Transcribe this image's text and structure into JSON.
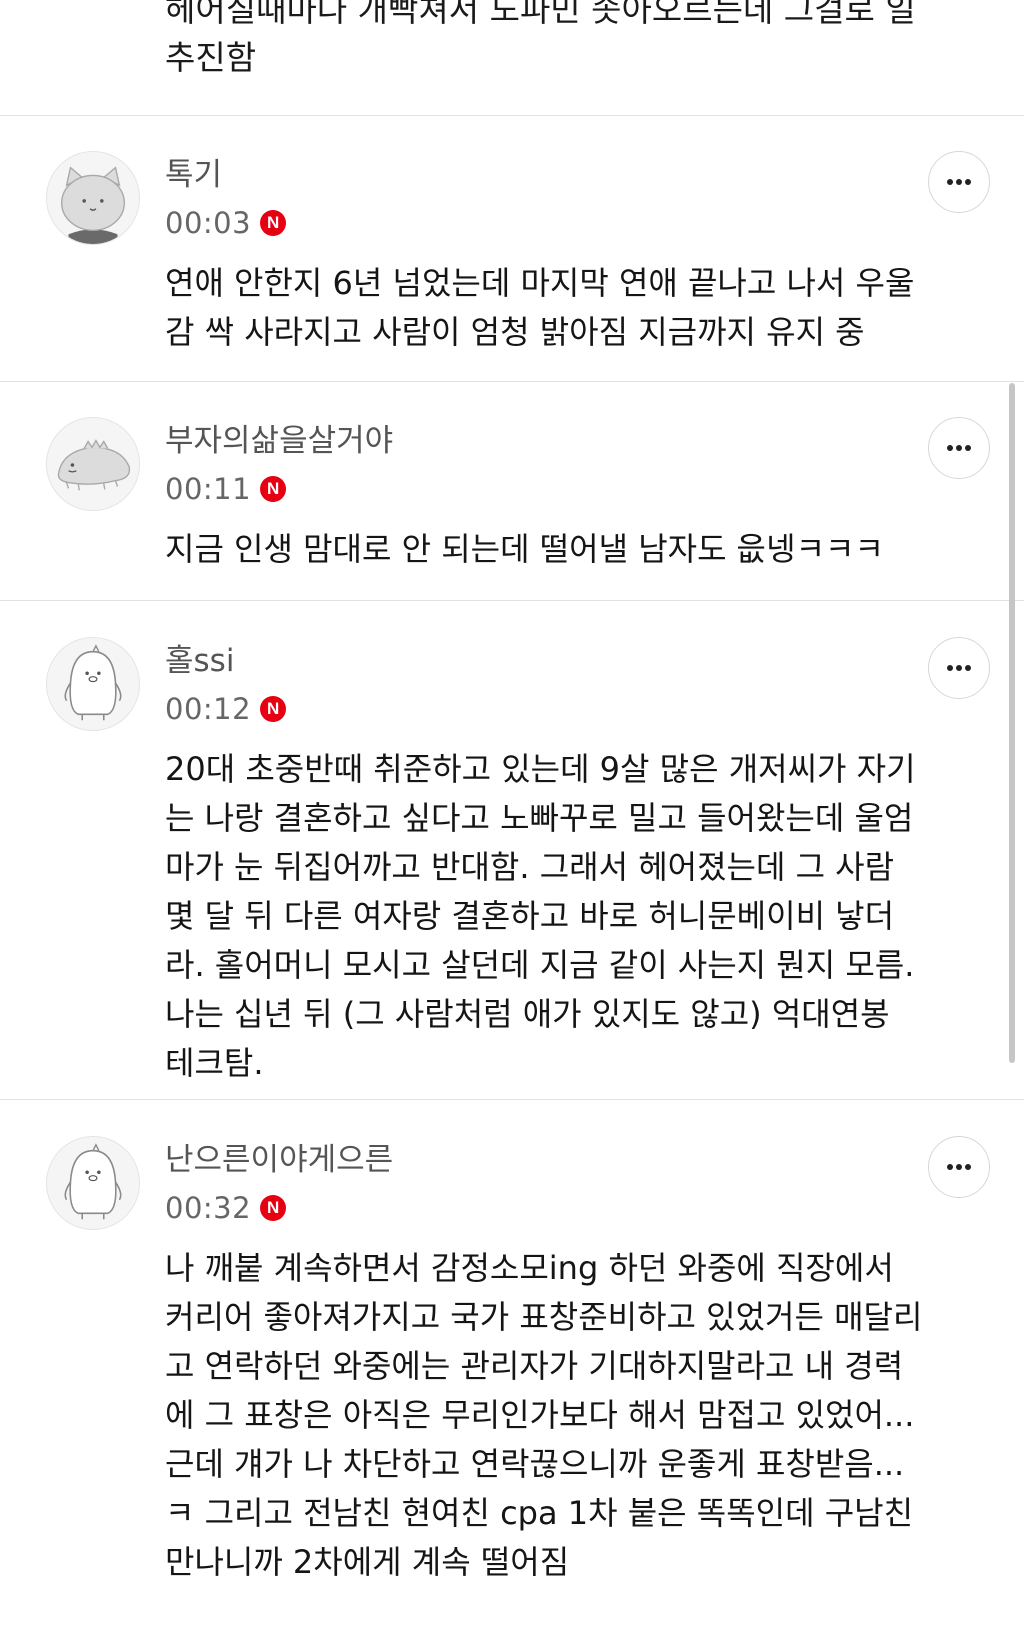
{
  "top_comment": {
    "text": "헤어질때마다 개빡쳐서 도파민 솟아오르는데 그걸로 일\n추진함"
  },
  "comments": [
    {
      "nickname": "톡기",
      "time": "00:03",
      "badge": "N",
      "avatar_icon": "cat-avatar-icon",
      "text": "연애 안한지 6년 넘었는데 마지막 연애 끝나고 나서 우울\n감 싹 사라지고 사람이 엄청 밝아짐 지금까지 유지 중"
    },
    {
      "nickname": "부자의삶을살거야",
      "time": "00:11",
      "badge": "N",
      "avatar_icon": "lizard-avatar-icon",
      "text": "지금 인생 맘대로 안 되는데 떨어낼 남자도 읎넹ㅋㅋㅋ"
    },
    {
      "nickname": "홀ssi",
      "time": "00:12",
      "badge": "N",
      "avatar_icon": "penguin-avatar-icon",
      "text": "20대 초중반때 취준하고 있는데 9살 많은 개저씨가 자기\n는 나랑 결혼하고 싶다고 노빠꾸로 밀고 들어왔는데 울엄\n마가 눈 뒤집어까고 반대함. 그래서 헤어졌는데 그 사람\n몇 달 뒤 다른 여자랑 결혼하고 바로 허니문베이비 낳더\n라. 홀어머니 모시고 살던데 지금 같이 사는지 뭔지 모름.\n나는 십년 뒤 (그 사람처럼 애가 있지도 않고) 억대연봉\n테크탐."
    },
    {
      "nickname": "난으른이야게으른",
      "time": "00:32",
      "badge": "N",
      "avatar_icon": "penguin-avatar-icon",
      "text": "나 깨붙 계속하면서 감정소모ing 하던 와중에 직장에서\n커리어 좋아져가지고 국가 표창준비하고 있었거든 매달리\n고 연락하던 와중에는 관리자가 기대하지말라고 내 경력\n에 그 표창은 아직은 무리인가보다 해서 맘접고 있었어...\n근데 걔가 나 차단하고 연락끊으니까 운좋게 표창받음...\nㅋ 그리고 전남친 현여친 cpa 1차 붙은 똑똑인데 구남친\n만나니까 2차에게 계속 떨어짐"
    }
  ],
  "colors": {
    "new_badge": "#e60012",
    "nickname": "#555555",
    "divider": "#e2e2e2"
  }
}
